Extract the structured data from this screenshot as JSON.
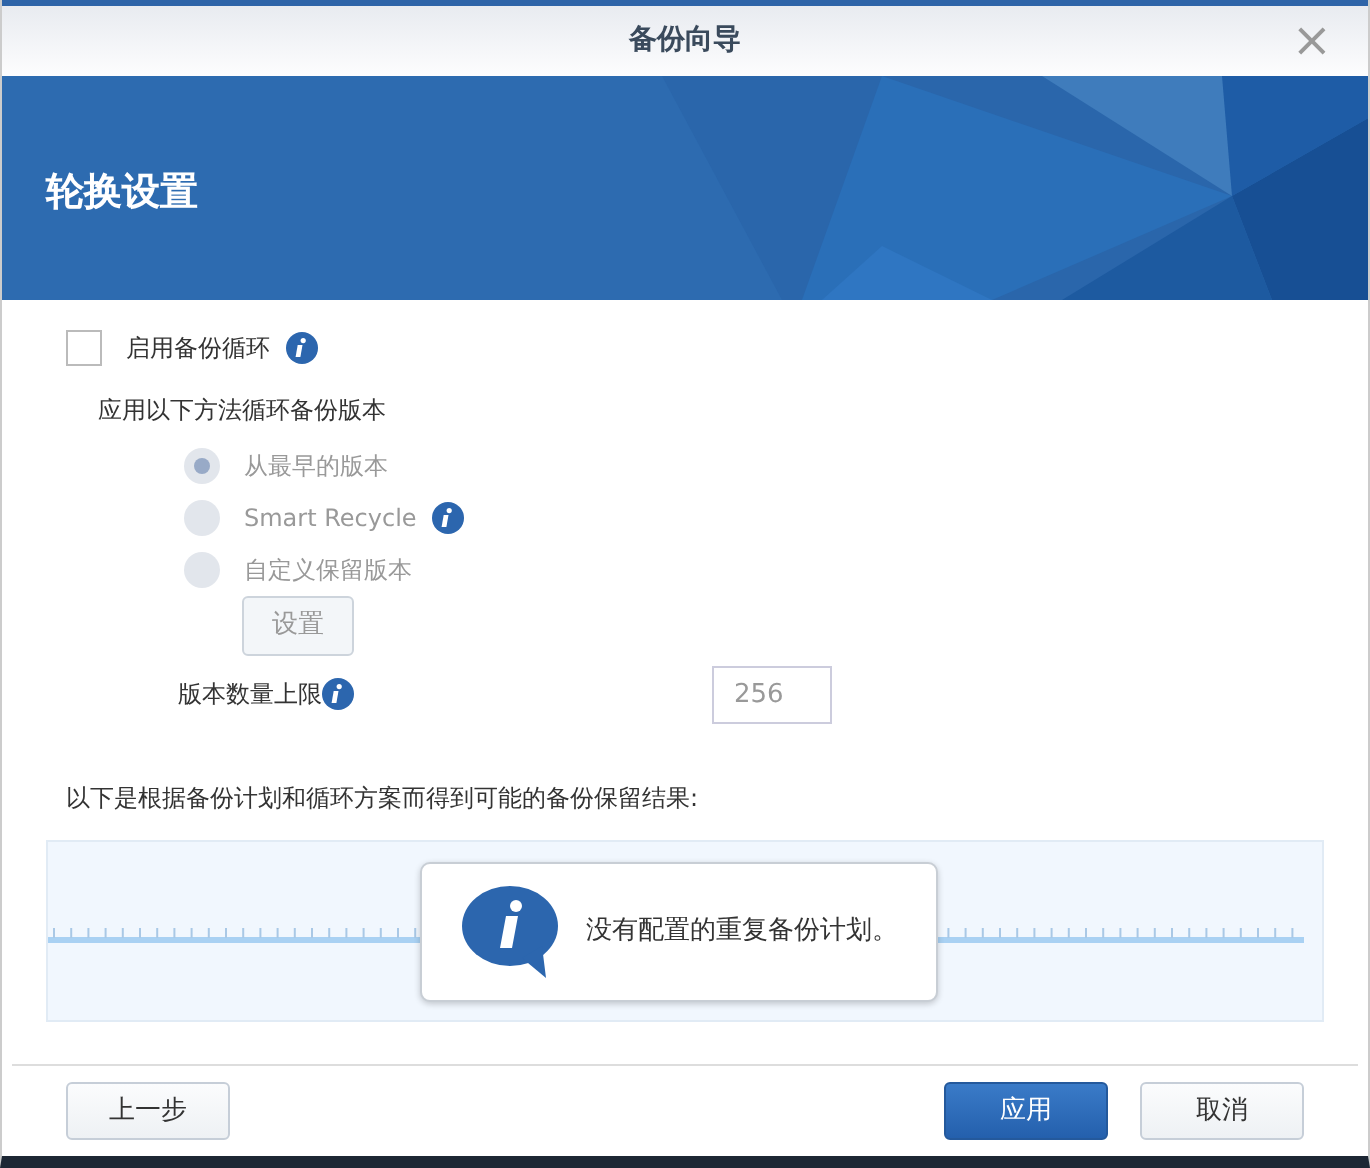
{
  "window": {
    "title": "备份向导",
    "close": "×"
  },
  "banner": {
    "title": "轮换设置"
  },
  "enable": {
    "label": "启用备份循环",
    "checked": false,
    "info": true
  },
  "method_label": "应用以下方法循环备份版本",
  "options": [
    {
      "label": "从最早的版本",
      "selected": true,
      "disabled": true,
      "info": false
    },
    {
      "label": "Smart Recycle",
      "selected": false,
      "disabled": true,
      "info": true
    },
    {
      "label": "自定义保留版本",
      "selected": false,
      "disabled": true,
      "info": false
    }
  ],
  "settings_button": {
    "label": "设置",
    "disabled": true
  },
  "limit": {
    "label": "版本数量上限",
    "value": "256",
    "disabled": true
  },
  "result_label": "以下是根据备份计划和循环方案而得到可能的备份保留结果:",
  "message": "没有配置的重复备份计划。",
  "buttons": [
    {
      "label": "上一步",
      "kind": "default"
    },
    {
      "label": "应用",
      "kind": "primary"
    },
    {
      "label": "取消",
      "kind": "default"
    }
  ]
}
